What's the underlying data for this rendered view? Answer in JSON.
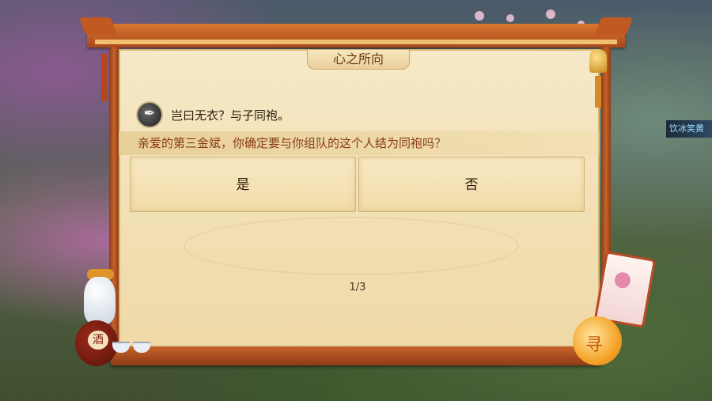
{
  "dialog": {
    "title": "心之所向",
    "npc_text": "岂曰无衣？与子同袍。",
    "question": "亲爱的第三金斌，你确定要与你组队的这个人结为同袍吗？",
    "options": [
      {
        "label": "是"
      },
      {
        "label": "否"
      }
    ],
    "page_indicator": "1/3"
  },
  "hud": {
    "player_tag": "饮冰笑黄"
  },
  "decor": {
    "lantern_glyph": "寻",
    "jar_glyph": "酒"
  }
}
